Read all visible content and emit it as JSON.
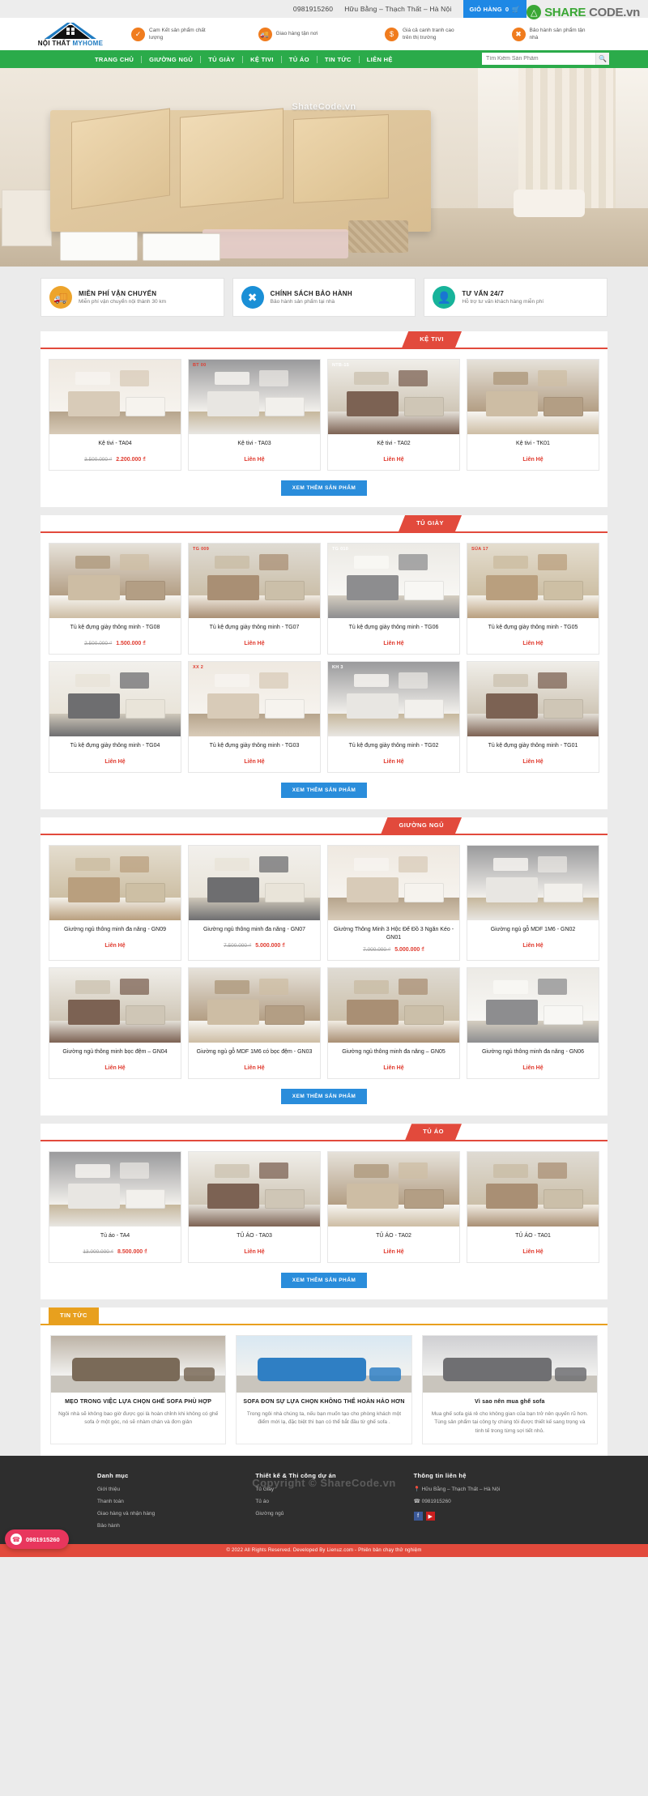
{
  "topbar": {
    "phone": "0981915260",
    "address": "Hữu Bằng – Thạch Thất – Hà Nội",
    "cart_label": "GIỎ HÀNG",
    "cart_count": "0",
    "cart_icon": "shopping-basket-icon"
  },
  "watermark": {
    "logo_icon": "sharecode-logo-icon",
    "part1": "SHARE",
    "part2": "CODE.vn",
    "banner_text": "ShateCode.vn",
    "footer_text": "Copyright © ShareCode.vn"
  },
  "logo": {
    "line_bold": "NỘI THẤT ",
    "line_accent": "MYHOME",
    "icon": "house-logo-icon"
  },
  "features": [
    {
      "icon": "check-circle-icon",
      "text": "Cam Kết sản phẩm chất lượng"
    },
    {
      "icon": "truck-icon",
      "text": "Giao hàng tận nơi"
    },
    {
      "icon": "dollar-icon",
      "text": "Giá cả canh tranh cao trên thị trường"
    },
    {
      "icon": "tools-icon",
      "text": "Bảo hành sản phẩm tận nhà"
    }
  ],
  "nav": {
    "items": [
      {
        "label": "TRANG CHỦ",
        "name": "nav-home"
      },
      {
        "label": "GIƯỜNG NGỦ",
        "name": "nav-beds"
      },
      {
        "label": "TỦ GIÀY",
        "name": "nav-shoe-cabinets"
      },
      {
        "label": "KỆ TIVI",
        "name": "nav-tv-shelves"
      },
      {
        "label": "TỦ ÁO",
        "name": "nav-wardrobes"
      },
      {
        "label": "TIN TỨC",
        "name": "nav-news"
      },
      {
        "label": "LIÊN HỆ",
        "name": "nav-contact"
      }
    ],
    "search_placeholder": "Tìm Kiếm Sản Phẩm",
    "search_value": "",
    "search_icon": "magnifier-icon"
  },
  "services": [
    {
      "icon": "truck-icon",
      "title": "MIỄN PHÍ VẬN CHUYỂN",
      "sub": "Miễn phí vận chuyển nội thành 30 km",
      "color": "#eda42c"
    },
    {
      "icon": "wrench-screwdriver-icon",
      "title": "CHÍNH SÁCH BẢO HÀNH",
      "sub": "Bảo hành sản phẩm tại nhà",
      "color": "#1a8fd6"
    },
    {
      "icon": "headset-agent-icon",
      "title": "TƯ VẤN 24/7",
      "sub": "Hỗ trợ tư vấn khách hàng miễn phí",
      "color": "#17b39a"
    }
  ],
  "more_button_label": "XEM THÊM SẢN PHẨM",
  "sections": [
    {
      "title": "KỆ TIVI",
      "name": "section-tv-shelves",
      "products": [
        {
          "name": "Kệ tivi - TA04",
          "old_price": "3.500.000 ₫",
          "price": "2.200.000 ₫",
          "contact": "",
          "badge": ""
        },
        {
          "name": "Kệ tivi - TA03",
          "old_price": "",
          "price": "",
          "contact": "Liên Hệ",
          "badge": "BT 00"
        },
        {
          "name": "Kệ tivi - TA02",
          "old_price": "",
          "price": "",
          "contact": "Liên Hệ",
          "badge": "NTB-15"
        },
        {
          "name": "Kệ tivi - TK01",
          "old_price": "",
          "price": "",
          "contact": "Liên Hệ",
          "badge": ""
        }
      ]
    },
    {
      "title": "TỦ GIÀY",
      "name": "section-shoe-cabinets",
      "products": [
        {
          "name": "Tủ kệ đựng giày thông minh - TG08",
          "old_price": "2.500.000 ₫",
          "price": "1.500.000 ₫",
          "contact": "",
          "badge": ""
        },
        {
          "name": "Tủ kệ đựng giày thông minh - TG07",
          "old_price": "",
          "price": "",
          "contact": "Liên Hệ",
          "badge": "TG 009"
        },
        {
          "name": "Tủ kệ đựng giày thông minh - TG06",
          "old_price": "",
          "price": "",
          "contact": "Liên Hệ",
          "badge": "TG 010"
        },
        {
          "name": "Tủ kệ đựng giày thông minh - TG05",
          "old_price": "",
          "price": "",
          "contact": "Liên Hệ",
          "badge": "SÚA 17"
        },
        {
          "name": "Tủ kệ đựng giày thông minh - TG04",
          "old_price": "",
          "price": "",
          "contact": "Liên Hệ",
          "badge": ""
        },
        {
          "name": "Tủ kệ đựng giày thông minh - TG03",
          "old_price": "",
          "price": "",
          "contact": "Liên Hệ",
          "badge": "XX 2"
        },
        {
          "name": "Tủ kệ đựng giày thông minh - TG02",
          "old_price": "",
          "price": "",
          "contact": "Liên Hệ",
          "badge": "KH 3"
        },
        {
          "name": "Tủ kệ đựng giày thông minh - TG01",
          "old_price": "",
          "price": "",
          "contact": "Liên Hệ",
          "badge": ""
        }
      ]
    },
    {
      "title": "GIƯỜNG NGỦ",
      "name": "section-beds",
      "products": [
        {
          "name": "Giường ngủ thông minh đa năng - GN09",
          "old_price": "",
          "price": "",
          "contact": "Liên Hệ",
          "badge": ""
        },
        {
          "name": "Giường ngủ thông minh đa năng - GN07",
          "old_price": "7.500.000 ₫",
          "price": "5.000.000 ₫",
          "contact": "",
          "badge": ""
        },
        {
          "name": "Giường Thông Minh 3 Hộc Để Đồ 3 Ngăn Kéo - GN01",
          "old_price": "7.000.000 ₫",
          "price": "5.000.000 ₫",
          "contact": "",
          "badge": ""
        },
        {
          "name": "Giường ngủ gỗ MDF 1M6 - GN02",
          "old_price": "",
          "price": "",
          "contact": "Liên Hệ",
          "badge": ""
        },
        {
          "name": "Giường ngủ thông minh bọc đệm – GN04",
          "old_price": "",
          "price": "",
          "contact": "Liên Hệ",
          "badge": ""
        },
        {
          "name": "Giường ngủ gỗ MDF 1M6 có bọc đệm - GN03",
          "old_price": "",
          "price": "",
          "contact": "Liên Hệ",
          "badge": ""
        },
        {
          "name": "Giường ngủ thông minh đa năng – GN05",
          "old_price": "",
          "price": "",
          "contact": "Liên Hệ",
          "badge": ""
        },
        {
          "name": "Giường ngủ thông minh đa năng - GN06",
          "old_price": "",
          "price": "",
          "contact": "Liên Hệ",
          "badge": ""
        }
      ]
    },
    {
      "title": "TỦ ÁO",
      "name": "section-wardrobes",
      "products": [
        {
          "name": "Tủ áo - TA4",
          "old_price": "13.000.000 ₫",
          "price": "8.500.000 ₫",
          "contact": "",
          "badge": ""
        },
        {
          "name": "TỦ ÁO - TA03",
          "old_price": "",
          "price": "",
          "contact": "Liên Hệ",
          "badge": ""
        },
        {
          "name": "TỦ ÁO - TA02",
          "old_price": "",
          "price": "",
          "contact": "Liên Hệ",
          "badge": ""
        },
        {
          "name": "TỦ ÁO - TA01",
          "old_price": "",
          "price": "",
          "contact": "Liên Hệ",
          "badge": ""
        }
      ]
    }
  ],
  "news": {
    "title": "TIN TỨC",
    "items": [
      {
        "title": "MẸO TRONG VIỆC LỰA CHỌN GHẾ SOFA PHÙ HỢP",
        "desc": "Ngôi nhà sẽ không bao giờ được gọi là hoàn chỉnh khi không có ghế sofa ở một góc, nó sẽ nhàm chán và đơn giản"
      },
      {
        "title": "SOFA ĐƠN SỰ LỰA CHỌN KHÔNG THỂ HOÀN HẢO HƠN",
        "desc": "Trong ngôi nhà chúng ta, nếu bạn muốn tạo cho phòng khách một điểm mới lạ, đặc biệt thì bạn có thể bắt đầu từ ghế sofa ."
      },
      {
        "title": "Vì sao nên mua ghế sofa",
        "desc": "Mua ghế sofa giá rẻ cho không gian của bạn trở nên quyến rũ hơn. Tùng sản phẩm tại công ty chúng tôi được thiết kế sang trọng và tinh tế trong từng sợi tiết nhỏ."
      }
    ]
  },
  "footer": {
    "columns": [
      {
        "heading": "Danh mục",
        "links": [
          "Giới thiệu",
          "Thanh toán",
          "Giao hàng và nhận hàng",
          "Bảo hành"
        ]
      },
      {
        "heading": "Thiết kế & Thi công dự án",
        "links": [
          "Tủ Giày",
          "Tủ áo",
          "Giường ngủ"
        ]
      },
      {
        "heading": "Thông tin liên hệ",
        "links": [
          "Hữu Bằng – Thạch Thất – Hà Nội",
          "0981915260"
        ],
        "location_icon": "map-pin-icon",
        "phone_icon": "phone-icon",
        "facebook_icon": "facebook-icon",
        "youtube_icon": "youtube-icon"
      }
    ],
    "bottom": "© 2022 All Rights Reserved. Developed By Lienuz.com - Phiên bản chạy thử nghiệm"
  },
  "hotline": {
    "number": "0981915260",
    "icon": "phone-icon"
  }
}
